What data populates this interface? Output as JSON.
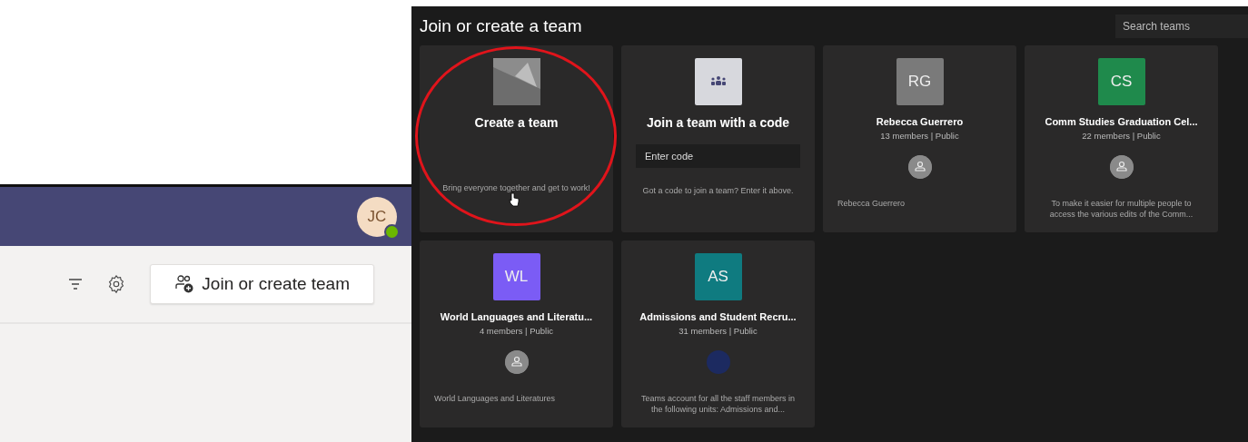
{
  "left_panel": {
    "avatar": {
      "initials": "JC",
      "available": true
    },
    "toolbar": {
      "join_button": "Join or create team"
    }
  },
  "dialog": {
    "title": "Join or create a team",
    "search": {
      "placeholder": "Search teams"
    },
    "cards": [
      {
        "kind": "create",
        "title": "Create a team",
        "description": "Bring everyone together and get to work!"
      },
      {
        "kind": "join",
        "title": "Join a team with a code",
        "field": {
          "placeholder": "Enter code"
        },
        "description": "Got a code to join a team? Enter it above."
      },
      {
        "kind": "team",
        "initials": "RG",
        "color": "#7a7a7a",
        "title": "Rebecca Guerrero",
        "meta": "13 members | Public",
        "owner_photo": false,
        "description": "Rebecca Guerrero"
      },
      {
        "kind": "team",
        "initials": "CS",
        "color": "#1f8a4c",
        "title": "Comm Studies Graduation Cel...",
        "meta": "22 members | Public",
        "owner_photo": false,
        "description": "To make it easier for multiple people to access the various edits of the Comm..."
      },
      {
        "kind": "team",
        "initials": "WL",
        "color": "#7b5cf5",
        "title": "World Languages and Literatu...",
        "meta": "4 members | Public",
        "owner_photo": false,
        "description": "World Languages and Literatures"
      },
      {
        "kind": "team",
        "initials": "AS",
        "color": "#0f7b80",
        "title": "Admissions and Student Recru...",
        "meta": "31 members | Public",
        "owner_photo": true,
        "description": "Teams account for all the staff members in the following units: Admissions and..."
      }
    ]
  }
}
